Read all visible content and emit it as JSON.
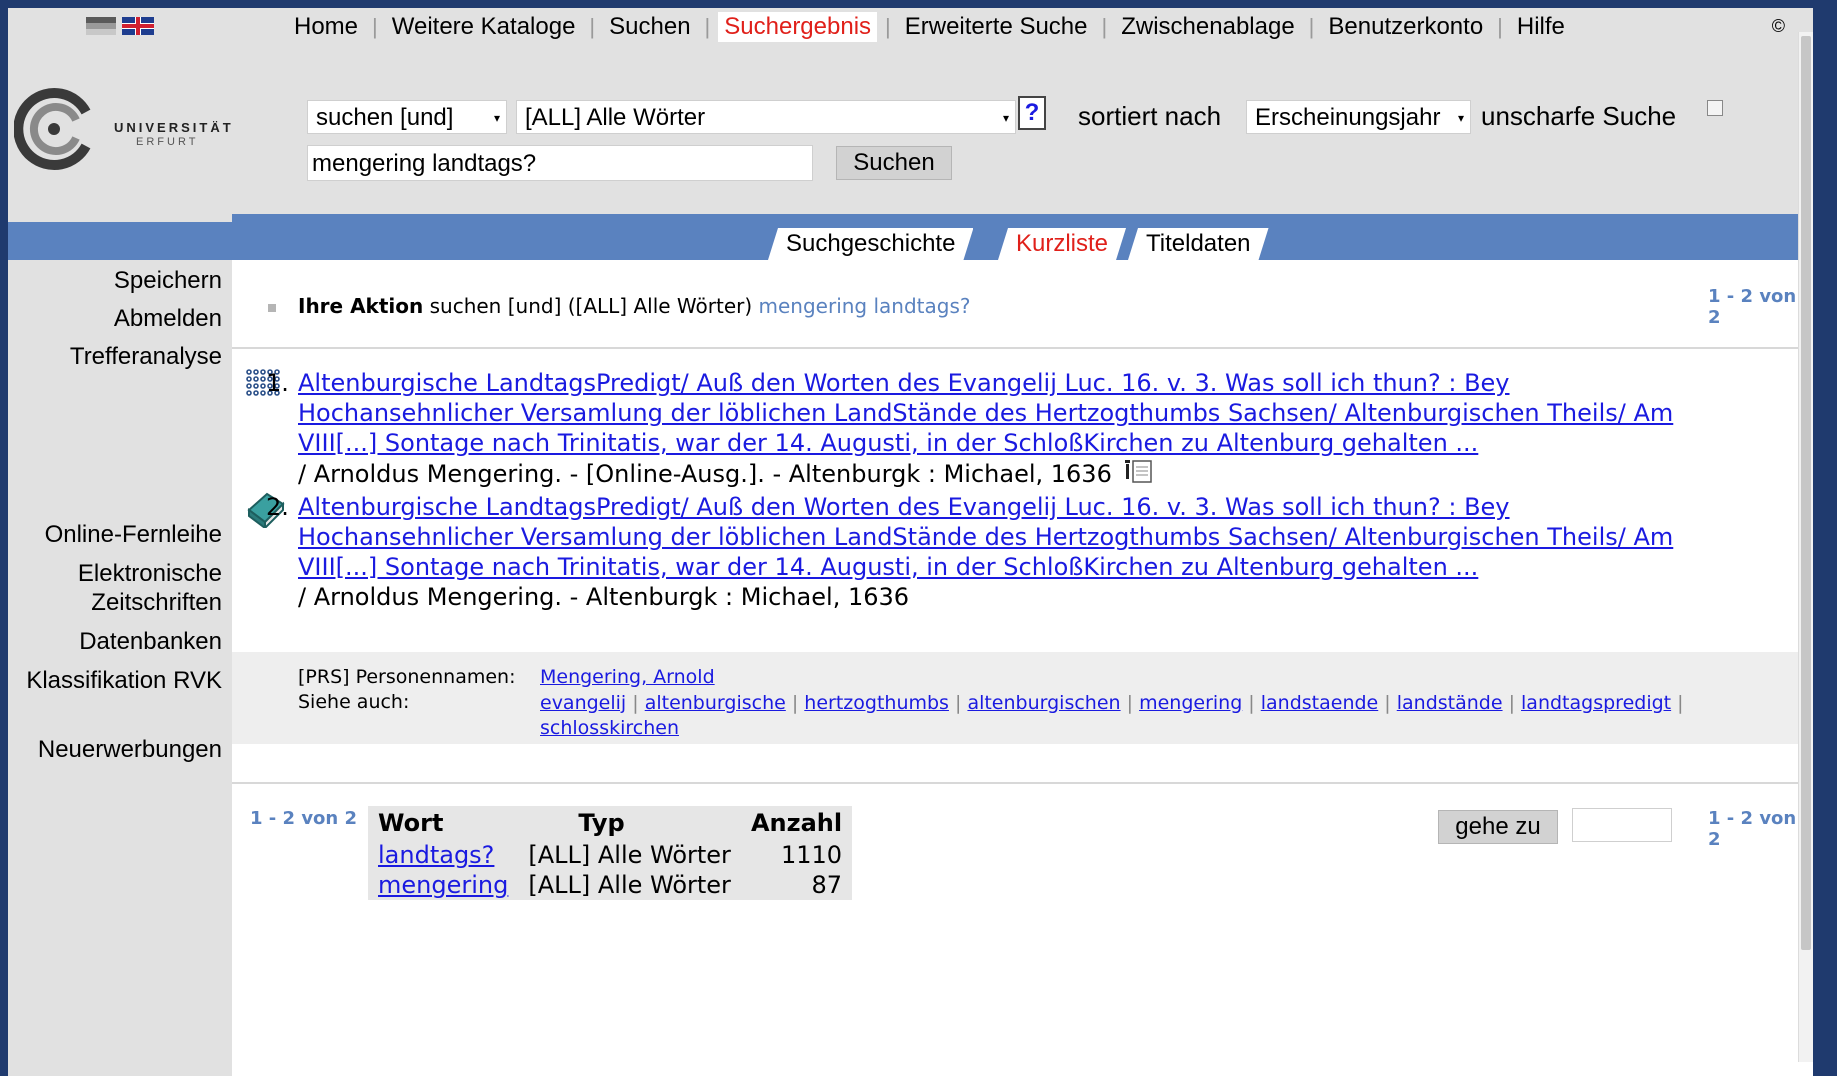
{
  "nav": {
    "items": [
      "Home",
      "Weitere Kataloge",
      "Suchen",
      "Suchergebnis",
      "Erweiterte Suche",
      "Zwischenablage",
      "Benutzerkonto",
      "Hilfe"
    ],
    "active": "Suchergebnis",
    "copyright": "©"
  },
  "logo": {
    "line1": "UNIVERSITÄT",
    "line2": "ERFURT"
  },
  "search": {
    "operator": "suchen [und]",
    "field": "[ALL] Alle Wörter",
    "help": "?",
    "sort_label": "sortiert nach",
    "sort_value": "Erscheinungsjahr",
    "fuzzy_label": "unscharfe Suche",
    "query": "mengering landtags?",
    "button": "Suchen"
  },
  "tabs": [
    "Suchgeschichte",
    "Kurzliste",
    "Titeldaten"
  ],
  "active_tab": "Kurzliste",
  "sidebar": {
    "top": [
      "Speichern",
      "Abmelden",
      "Trefferanalyse"
    ],
    "bottom": [
      "Online-Fernleihe",
      "Elektronische Zeitschriften",
      "Datenbanken",
      "Klassifikation RVK",
      "Neuerwerbungen"
    ]
  },
  "action": {
    "label": "Ihre Aktion",
    "text": "suchen [und] ([ALL] Alle Wörter)",
    "query": "mengering landtags?"
  },
  "count_text": "1 - 2 von 2",
  "results": [
    {
      "num": "1.",
      "title_line1": "Altenburgische LandtagsPredigt/ Auß den Worten des Evangelij Luc. 16. v. 3. Was soll ich thun? : Bey",
      "title_line2": "Hochansehnlicher Versamlung der löblichen LandStände des Hertzogthumbs Sachsen/ Altenburgischen Theils/ Am",
      "title_line3": "VIII[...] Sontage nach Trinitatis, war der 14. Augusti, in der SchloßKirchen zu Altenburg gehalten ...",
      "meta": "/ Arnoldus Mengering. - [Online-Ausg.]. - Altenburgk : Michael, 1636",
      "icon": "digital-media-icon"
    },
    {
      "num": "2.",
      "title_line1": "Altenburgische LandtagsPredigt/ Auß den Worten des Evangelij Luc. 16. v. 3. Was soll ich thun? : Bey",
      "title_line2": "Hochansehnlicher Versamlung der löblichen LandStände des Hertzogthumbs Sachsen/ Altenburgischen Theils/ Am",
      "title_line3": "VIII[...] Sontage nach Trinitatis, war der 14. Augusti, in der SchloßKirchen zu Altenburg gehalten ...",
      "meta": "/ Arnoldus Mengering. - Altenburgk : Michael, 1636",
      "icon": "book-icon"
    }
  ],
  "related": {
    "persons_label": "[PRS] Personennamen:",
    "person": "Mengering, Arnold",
    "see_also_label": "Siehe auch:",
    "see_also": [
      "evangelij",
      "altenburgische",
      "hertzogthumbs",
      "altenburgischen",
      "mengering",
      "landstaende",
      "landstände",
      "landtagspredigt",
      "schlosskirchen"
    ]
  },
  "word_table": {
    "headers": [
      "Wort",
      "Typ",
      "Anzahl"
    ],
    "rows": [
      {
        "word": "landtags?",
        "type": "[ALL] Alle Wörter",
        "count": "1110"
      },
      {
        "word": "mengering",
        "type": "[ALL] Alle Wörter",
        "count": "87"
      }
    ]
  },
  "goto": {
    "button": "gehe zu",
    "value": ""
  },
  "colors": {
    "accent_blue": "#5a82bf",
    "active_red": "#e0201a",
    "link": "#1a1ae0",
    "panel_gray": "#e1e1e1"
  }
}
